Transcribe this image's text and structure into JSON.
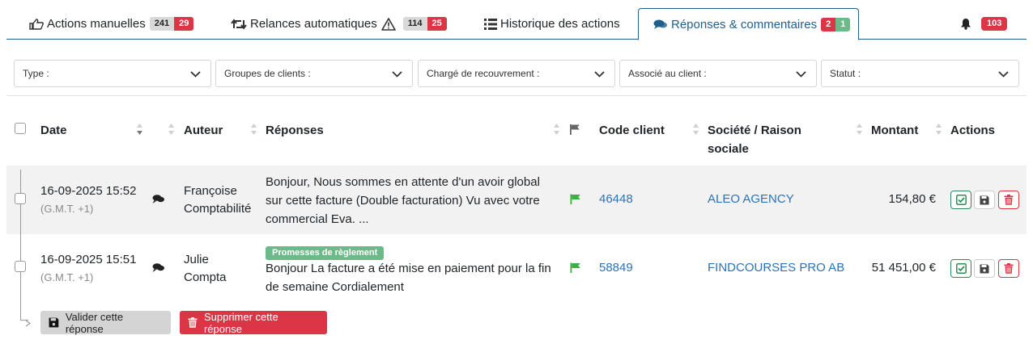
{
  "tabs": [
    {
      "label": "Actions manuelles",
      "count_total": "241",
      "count_alert": "29"
    },
    {
      "label": "Relances automatiques",
      "count_total": "114",
      "count_alert": "25"
    },
    {
      "label": "Historique des actions"
    },
    {
      "label": "Réponses & commentaires",
      "count_alert": "2",
      "count_ok": "1"
    }
  ],
  "notifications": {
    "count": "103"
  },
  "filters": {
    "type": "Type :",
    "groups": "Groupes de clients :",
    "collector": "Chargé de recouvrement :",
    "associate": "Associé au client :",
    "status": "Statut :"
  },
  "table": {
    "headers": {
      "date": "Date",
      "author": "Auteur",
      "replies": "Réponses",
      "client_code": "Code client",
      "company_line1": "Société / Raison",
      "company_line2": "sociale",
      "amount": "Montant",
      "actions": "Actions"
    },
    "rows": [
      {
        "date": "16-09-2025 15:52",
        "tz": "(G.M.T. +1)",
        "author_line1": "Françoise",
        "author_line2": "Comptabilité",
        "tag": "",
        "reply_line1": "Bonjour, Nous sommes en attente d'un avoir global",
        "reply_line2": "sur cette facture (Double facturation) Vu avec votre",
        "reply_line3": "commercial Eva. ...",
        "client_code": "46448",
        "company": "ALEO AGENCY",
        "amount": "154,80 €"
      },
      {
        "date": "16-09-2025 15:51",
        "tz": "(G.M.T. +1)",
        "author_line1": "Julie",
        "author_line2": "Compta",
        "tag": "Promesses de règlement",
        "reply_line1": "Bonjour La facture a été mise en paiement pour la fin",
        "reply_line2": "de semaine Cordialement",
        "client_code": "58849",
        "company": "FINDCOURSES PRO AB",
        "amount": "51 451,00 €"
      }
    ]
  },
  "bulk": {
    "validate": "Valider cette réponse",
    "delete": "Supprimer cette réponse"
  },
  "colors": {
    "accent": "#1f5f8b",
    "link": "#2b73b8",
    "danger": "#dc3545",
    "success": "#6cb98a",
    "flag": "#3cb043"
  }
}
